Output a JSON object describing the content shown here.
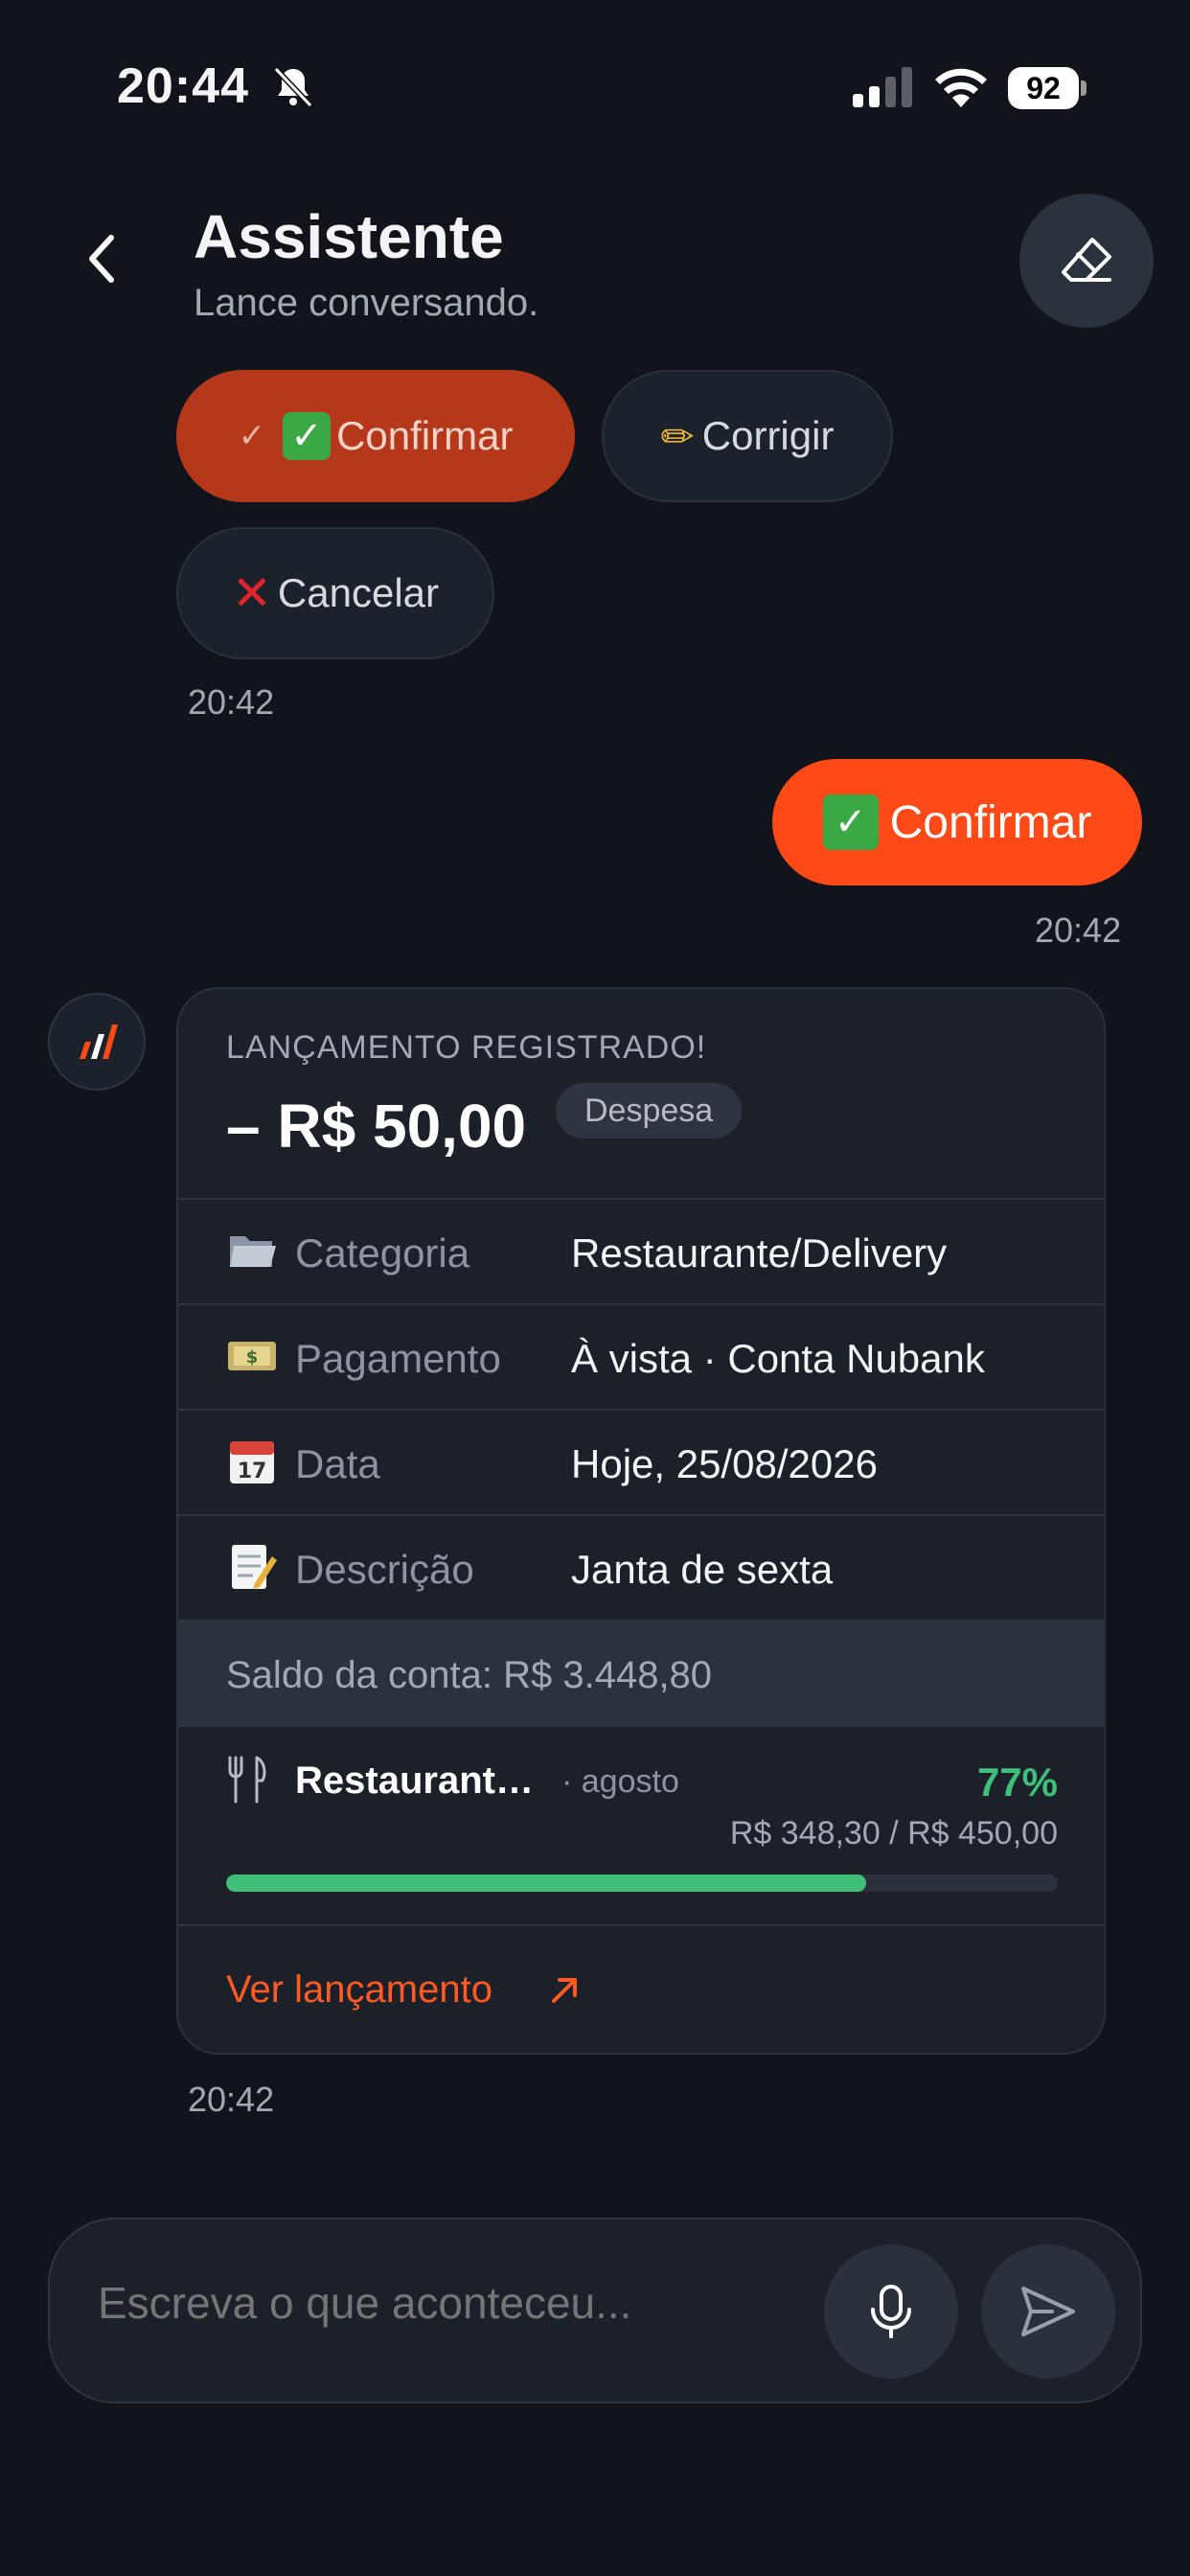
{
  "status_bar": {
    "time": "20:44",
    "battery": "92"
  },
  "header": {
    "title": "Assistente",
    "subtitle": "Lance conversando."
  },
  "quick_replies": {
    "confirm": "Confirmar",
    "corrigir": "Corrigir",
    "cancelar": "Cancelar",
    "timestamp": "20:42"
  },
  "user_message": {
    "text": "Confirmar",
    "timestamp": "20:42"
  },
  "card": {
    "heading": "LANÇAMENTO REGISTRADO!",
    "amount": "– R$ 50,00",
    "badge": "Despesa",
    "rows": [
      {
        "icon": "folder-icon",
        "label": "Categoria",
        "value": "Restaurante/Delivery"
      },
      {
        "icon": "money-icon",
        "label": "Pagamento",
        "value": "À vista · Conta Nubank"
      },
      {
        "icon": "calendar-icon",
        "label": "Data",
        "value": "Hoje, 25/08/2026"
      },
      {
        "icon": "memo-icon",
        "label": "Descrição",
        "value": "Janta de sexta"
      }
    ],
    "saldo": "Saldo da conta: R$ 3.448,80",
    "budget": {
      "name": "Restaurant…",
      "month": "· agosto",
      "percent": "77%",
      "amounts": "R$ 348,30 / R$ 450,00",
      "progress": 0.77
    },
    "link": "Ver lançamento",
    "timestamp": "20:42"
  },
  "composer": {
    "placeholder": "Escreva o que aconteceu..."
  },
  "colors": {
    "accent": "#ff4a17",
    "success": "#3fbf7a",
    "background": "#11141b"
  }
}
